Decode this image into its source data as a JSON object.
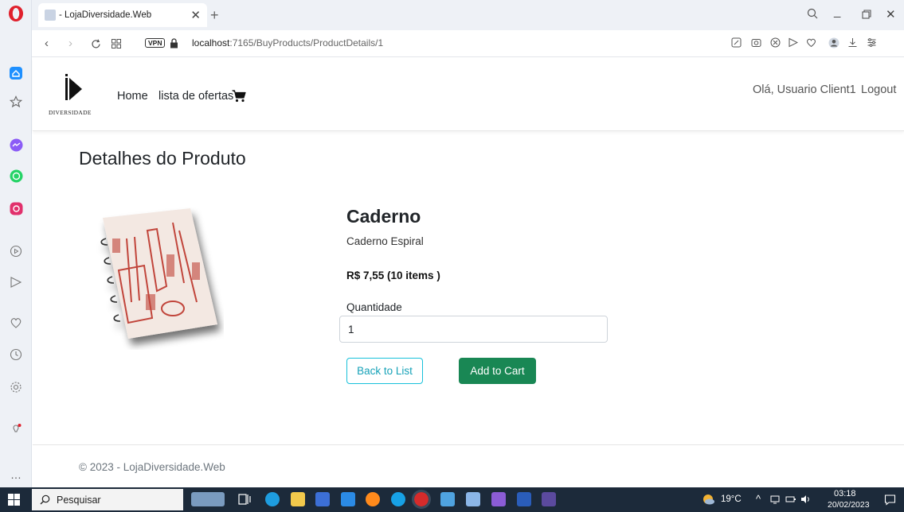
{
  "browser": {
    "tab_title": "- LojaDiversidade.Web",
    "url_host": "localhost",
    "url_rest": ":7165/BuyProducts/ProductDetails/1",
    "vpn_label": "VPN"
  },
  "site": {
    "logo_text": "DIVERSIDADE",
    "nav": {
      "home": "Home",
      "offers": "lista de ofertas"
    },
    "user": {
      "greeting": "Olá, Usuario Client1",
      "logout": "Logout"
    }
  },
  "page": {
    "title": "Detalhes do Produto"
  },
  "product": {
    "name": "Caderno",
    "description": "Caderno Espiral",
    "price_line": "R$ 7,55 (10 items )",
    "quantity_label": "Quantidade",
    "quantity_value": "1",
    "back_button": "Back to List",
    "add_button": "Add to Cart"
  },
  "footer": {
    "text": "© 2023 - LojaDiversidade.Web"
  },
  "taskbar": {
    "search_placeholder": "Pesquisar",
    "weather": "19°C",
    "time": "03:18",
    "date": "20/02/2023"
  },
  "colors": {
    "accent_green": "#198754",
    "accent_info": "#17a2b8",
    "taskbar_bg": "#1c2a3a"
  }
}
